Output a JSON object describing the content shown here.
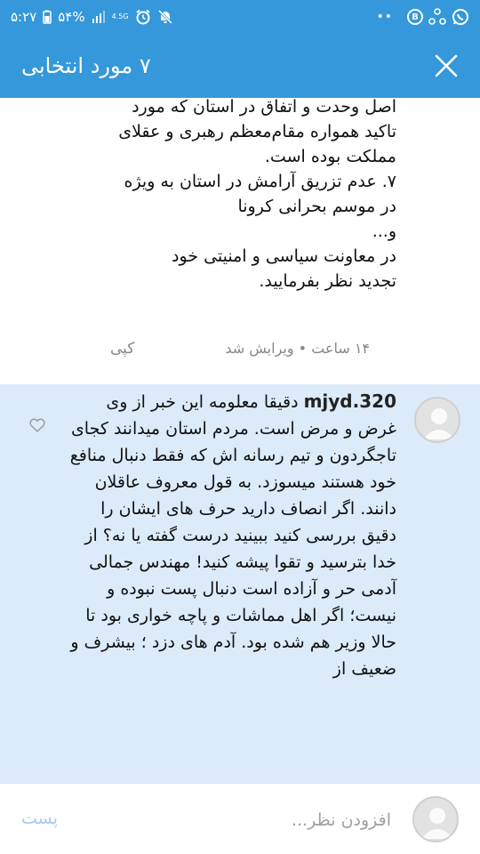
{
  "status_bar": {
    "time": "۵:۲۷",
    "battery": "۵۴%",
    "network": "4.5G",
    "icons": [
      "battery-icon",
      "signal-icon",
      "alarm-icon",
      "mute-icon",
      "more-dots-icon",
      "b-app-icon",
      "sync-icon",
      "whatsapp-icon"
    ]
  },
  "action_bar": {
    "title": "۷ مورد انتخابی",
    "close_icon": "close-icon"
  },
  "previous_comment": {
    "text": "اصل وحدت و اتفاق در استان که مورد\nتاکید همواره مقام‌معظم رهبری و عقلای\nمملکت بوده است.\n۷. عدم تزریق آرامش در استان به ویژه\nدر موسم بحرانی کرونا\nو...\nدر معاونت سیاسی و امنیتی خود\nتجدید نظر بفرمایید.",
    "meta": "۱۴ ساعت • ویرایش شد",
    "copy_label": "کپی"
  },
  "selected_comment": {
    "username": "320.mjyd",
    "text": "دقیقا معلومه این خبر از وی غرض و مرض است. مردم استان میدانند کجای تاجگردون و تیم رسانه اش که فقط دنبال منافع خود هستند میسوزد. به قول معروف عاقلان دانند. اگر انصاف دارید حرف های ایشان را  دقیق بررسی کنید ببینید درست گفته یا نه؟ از خدا بترسید و تقوا پیشه کنید! مهندس جمالی آدمی حر و آزاده است دنبال پست  نبوده و نیست؛ اگر اهل مماشات و پاچه خواری بود تا حالا وزیر هم شده بود. آدم های دزد ؛ بیشرف و ضعیف از"
  },
  "input_bar": {
    "placeholder": "افزودن نظر...",
    "post_label": "پست"
  },
  "colors": {
    "accent": "#3498db",
    "selected_bg": "#dcebfa",
    "post_disabled": "#a9c9ea"
  }
}
